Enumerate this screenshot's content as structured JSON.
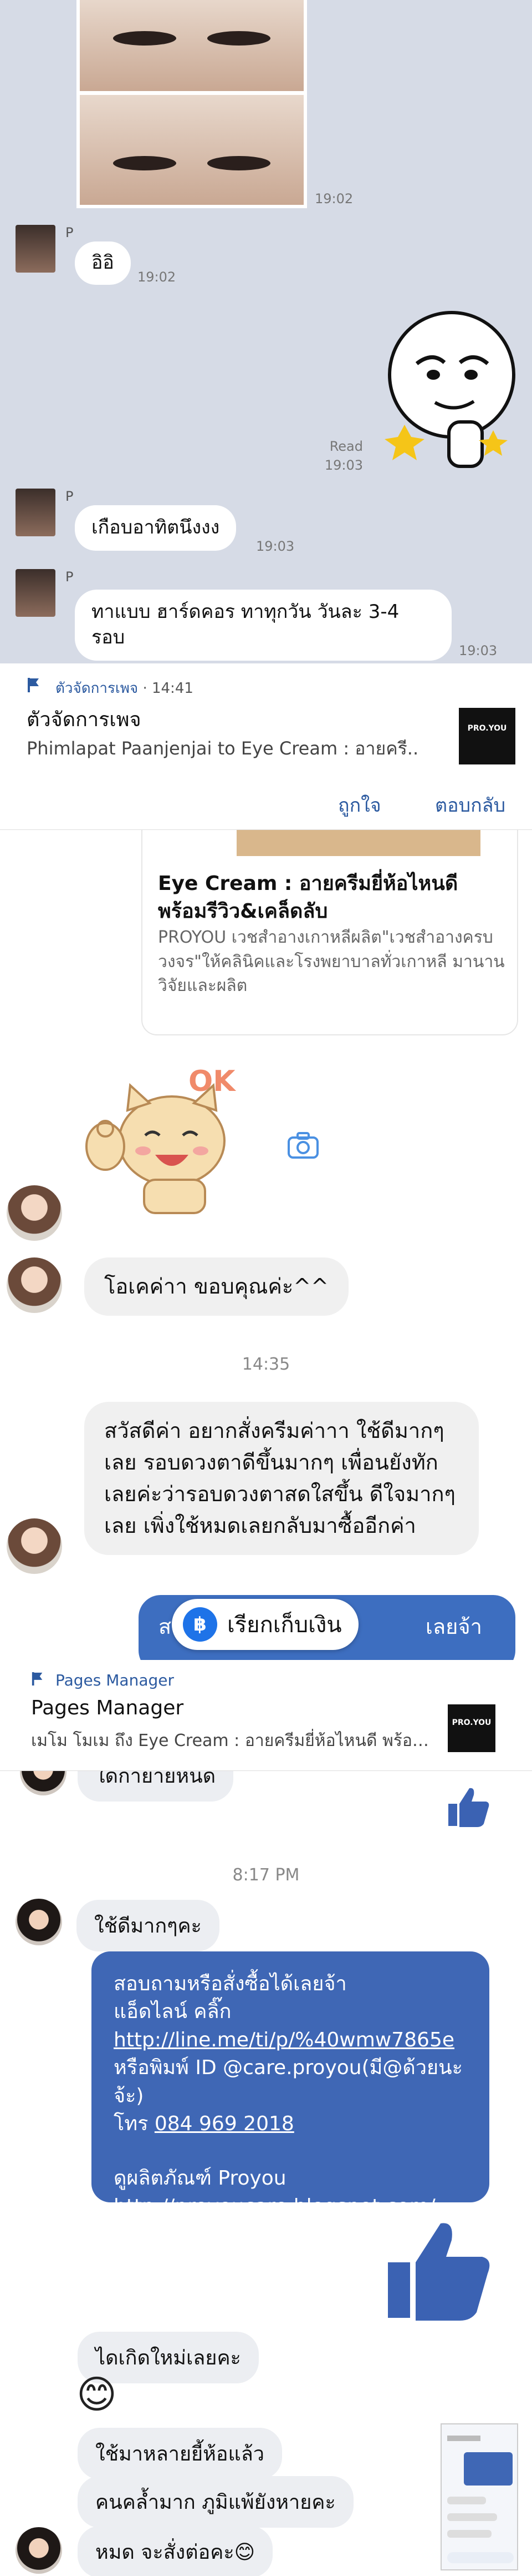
{
  "line_chat": {
    "photo_time": "19:02",
    "sender_initial": "P",
    "msg1": "อิอิ",
    "msg1_time": "19:02",
    "read_label": "Read",
    "read_time": "19:03",
    "msg2": "เกือบอาทิตนึงงง",
    "msg2_time": "19:03",
    "msg3_line1": "ทาแบบ ฮาร์ดคอร ทาทุกวัน วันละ 3-4",
    "msg3_line2": "รอบ",
    "msg3_time": "19:03"
  },
  "notification1": {
    "app_name": "ตัวจัดการเพจ",
    "app_time": "14:41",
    "title": "ตัวจัดการเพจ",
    "body": "Phimlapat Paanjenjai to Eye Cream : อายครี..",
    "thumb_text": "PRO.YOU",
    "action_like": "ถูกใจ",
    "action_reply": "ตอบกลับ"
  },
  "messenger_chat": {
    "card_title": "Eye Cream : อายครีมยี่ห้อไหนดี พร้อมรีวิว&เคล็ดลับ",
    "card_desc": "PROYOU เวชสำอางเกาหลีผลิต\"เวชสำอางครบวงจร\"ให้คลินิคและโรงพยาบาลทั่วเกาหลี มานาน วิจัยและผลิต",
    "sticker_ok": "OK",
    "msg_ok": "โอเคค่าา ขอบคุณค่ะ^^",
    "center_time": "14:35",
    "msg_long": "สวัสดีค่า อยากสั่งครีมค่าาา ใช้ดีมากๆเลย รอบดวงตาดีขึ้นมากๆ เพื่อนยังทักเลยค่ะว่ารอบดวงตาสดใสขึ้น ดีใจมากๆเลย เพิ่งใช้หมดเลยกลับมาซื้ออีกค่า",
    "blue_partial": "ส",
    "blue_partial2": "เลยจ้า",
    "pill_label": "เรียกเก็บเงิน",
    "pill_icon": "฿"
  },
  "notification2": {
    "app_name": "Pages Manager",
    "title": "Pages Manager",
    "body": "เมโม โมเม ถึง Eye Cream : อายครีมยี่ห้อไหนดี พร้อม..",
    "thumb_text": "PRO.YOU"
  },
  "pm_chat": {
    "partial_top": "ใดกายายหนด",
    "center_time": "8:17 PM",
    "msg_good": "ใช้ดีมากๆคะ",
    "info_line1": "สอบถามหรือสั่งซื้อได้เลยจ้า",
    "info_line2": "แอ็ดไลน์ คลิ๊ก",
    "info_link1": "http://line.me/ti/p/%40wmw7865e",
    "info_line3": "หรือพิมพ์ ID @care.proyou(มี@ด้วยนะจ้ะ)",
    "info_phone_label": "โทร",
    "info_phone": "084 969 2018",
    "info_line4": "ดูผลิตภัณฑ์ Proyou",
    "info_link2": "http://proyoucare.blogspot.com/",
    "msg_new": "ไดเกิดใหม่เลยคะ",
    "emoji": "😊",
    "msg_brand": "ใช้มาหลายยี้ห้อแล้ว",
    "msg_dark": "คนคล้ำมาก ภูมิแพ้ยังหายคะ",
    "msg_done": "หมด จะสั่งต่อคะ😊"
  }
}
